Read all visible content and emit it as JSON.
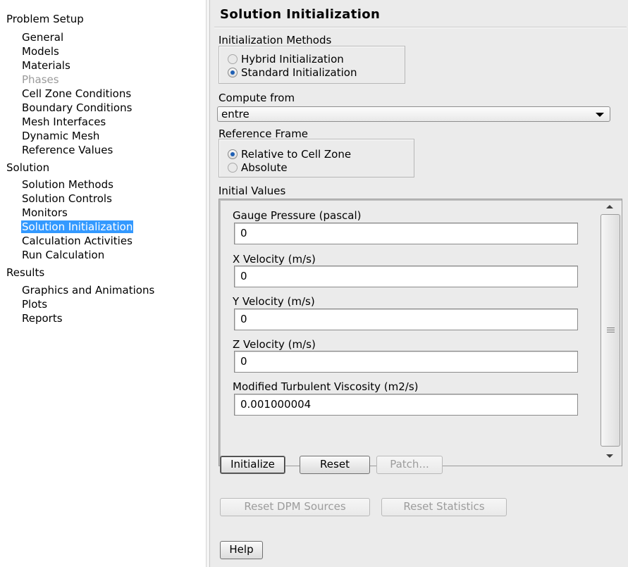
{
  "nav": {
    "sections": [
      {
        "label": "Problem Setup",
        "items": [
          {
            "label": "General",
            "state": "normal"
          },
          {
            "label": "Models",
            "state": "normal"
          },
          {
            "label": "Materials",
            "state": "normal"
          },
          {
            "label": "Phases",
            "state": "disabled"
          },
          {
            "label": "Cell Zone Conditions",
            "state": "normal"
          },
          {
            "label": "Boundary Conditions",
            "state": "normal"
          },
          {
            "label": "Mesh Interfaces",
            "state": "normal"
          },
          {
            "label": "Dynamic Mesh",
            "state": "normal"
          },
          {
            "label": "Reference Values",
            "state": "normal"
          }
        ]
      },
      {
        "label": "Solution",
        "items": [
          {
            "label": "Solution Methods",
            "state": "normal"
          },
          {
            "label": "Solution Controls",
            "state": "normal"
          },
          {
            "label": "Monitors",
            "state": "normal"
          },
          {
            "label": "Solution Initialization",
            "state": "selected"
          },
          {
            "label": "Calculation Activities",
            "state": "normal"
          },
          {
            "label": "Run Calculation",
            "state": "normal"
          }
        ]
      },
      {
        "label": "Results",
        "items": [
          {
            "label": "Graphics and Animations",
            "state": "normal"
          },
          {
            "label": "Plots",
            "state": "normal"
          },
          {
            "label": "Reports",
            "state": "normal"
          }
        ]
      }
    ]
  },
  "panel": {
    "title": "Solution Initialization",
    "init_methods": {
      "label": "Initialization Methods",
      "options": [
        {
          "label": "Hybrid Initialization",
          "checked": false
        },
        {
          "label": "Standard Initialization",
          "checked": true
        }
      ]
    },
    "compute_from": {
      "label": "Compute from",
      "selected": "entre"
    },
    "reference_frame": {
      "label": "Reference Frame",
      "options": [
        {
          "label": "Relative to Cell Zone",
          "checked": true
        },
        {
          "label": "Absolute",
          "checked": false
        }
      ]
    },
    "initial_values": {
      "label": "Initial Values",
      "fields": [
        {
          "label": "Gauge Pressure (pascal)",
          "value": "0"
        },
        {
          "label": "X Velocity (m/s)",
          "value": "0"
        },
        {
          "label": "Y Velocity (m/s)",
          "value": "0"
        },
        {
          "label": "Z Velocity (m/s)",
          "value": "0"
        },
        {
          "label": "Modified Turbulent Viscosity (m2/s)",
          "value": "0.001000004"
        }
      ]
    },
    "buttons": {
      "initialize": "Initialize",
      "reset": "Reset",
      "patch": "Patch...",
      "reset_dpm": "Reset DPM Sources",
      "reset_stats": "Reset Statistics",
      "help": "Help"
    }
  },
  "colors": {
    "selection": "#3399ff",
    "panel_bg": "#ebebeb",
    "radio_dot": "#1e5fb4",
    "disabled_text": "#9a9a9a"
  }
}
